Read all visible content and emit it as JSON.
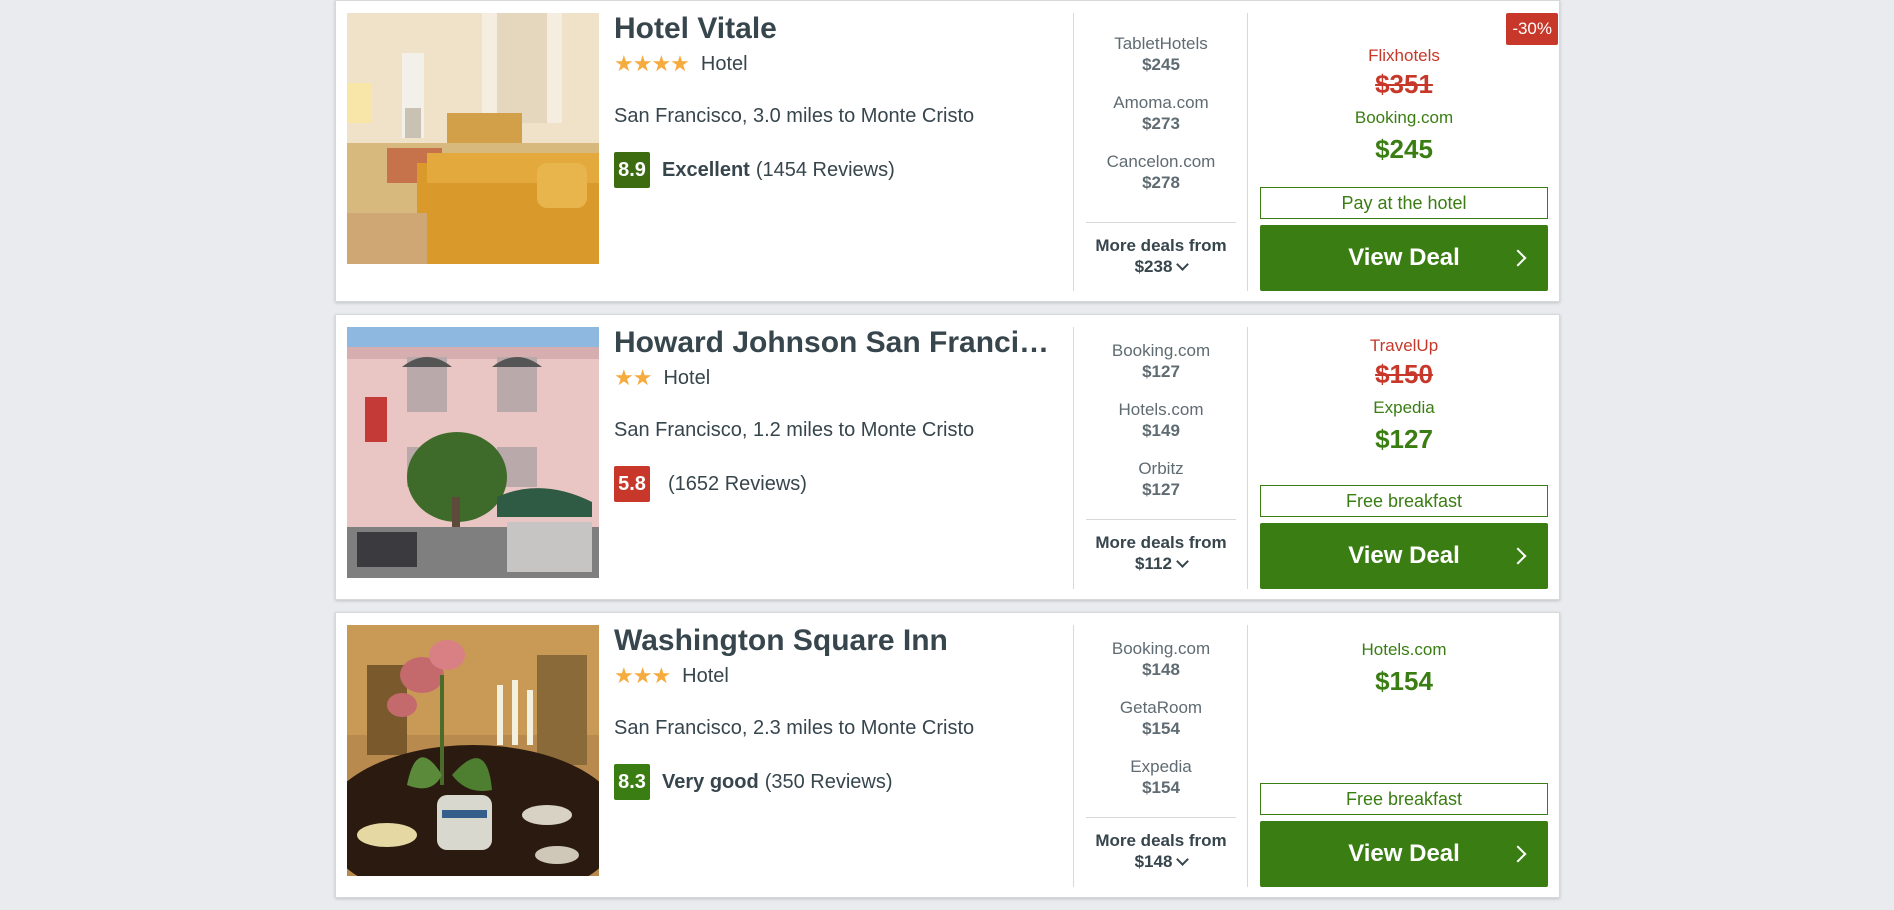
{
  "colors": {
    "accent_green": "#3a7d12",
    "price_red": "#c7382a",
    "star_orange": "#f6ab3f",
    "background": "#e9ebee"
  },
  "hotels": [
    {
      "name": "Hotel Vitale",
      "stars": "★★★★",
      "star_count": 4,
      "type": "Hotel",
      "location": "San Francisco, 3.0 miles to Monte Cristo",
      "score": "8.9",
      "rating_label": "Excellent",
      "reviews": "(1454 Reviews)",
      "deals": [
        {
          "provider": "TabletHotels",
          "price": "$245"
        },
        {
          "provider": "Amoma.com",
          "price": "$273"
        },
        {
          "provider": "Cancelon.com",
          "price": "$278"
        }
      ],
      "more_deals_label": "More deals from",
      "more_deals_price": "$238",
      "discount": "-30%",
      "old_provider": "Flixhotels",
      "old_price": "$351",
      "new_provider": "Booking.com",
      "new_price": "$245",
      "perk": "Pay at the hotel",
      "cta": "View Deal"
    },
    {
      "name": "Howard Johnson San Franci…",
      "stars": "★★",
      "star_count": 2,
      "type": "Hotel",
      "location": "San Francisco, 1.2 miles to Monte Cristo",
      "score": "5.8",
      "rating_label": "",
      "reviews": "(1652 Reviews)",
      "deals": [
        {
          "provider": "Booking.com",
          "price": "$127"
        },
        {
          "provider": "Hotels.com",
          "price": "$149"
        },
        {
          "provider": "Orbitz",
          "price": "$127"
        }
      ],
      "more_deals_label": "More deals from",
      "more_deals_price": "$112",
      "old_provider": "TravelUp",
      "old_price": "$150",
      "new_provider": "Expedia",
      "new_price": "$127",
      "perk": "Free breakfast",
      "cta": "View Deal"
    },
    {
      "name": "Washington Square Inn",
      "stars": "★★★",
      "star_count": 3,
      "type": "Hotel",
      "location": "San Francisco, 2.3 miles to Monte Cristo",
      "score": "8.3",
      "rating_label": "Very good",
      "reviews": "(350 Reviews)",
      "deals": [
        {
          "provider": "Booking.com",
          "price": "$148"
        },
        {
          "provider": "GetaRoom",
          "price": "$154"
        },
        {
          "provider": "Expedia",
          "price": "$154"
        }
      ],
      "more_deals_label": "More deals from",
      "more_deals_price": "$148",
      "new_provider": "Hotels.com",
      "new_price": "$154",
      "perk": "Free breakfast",
      "cta": "View Deal"
    }
  ]
}
